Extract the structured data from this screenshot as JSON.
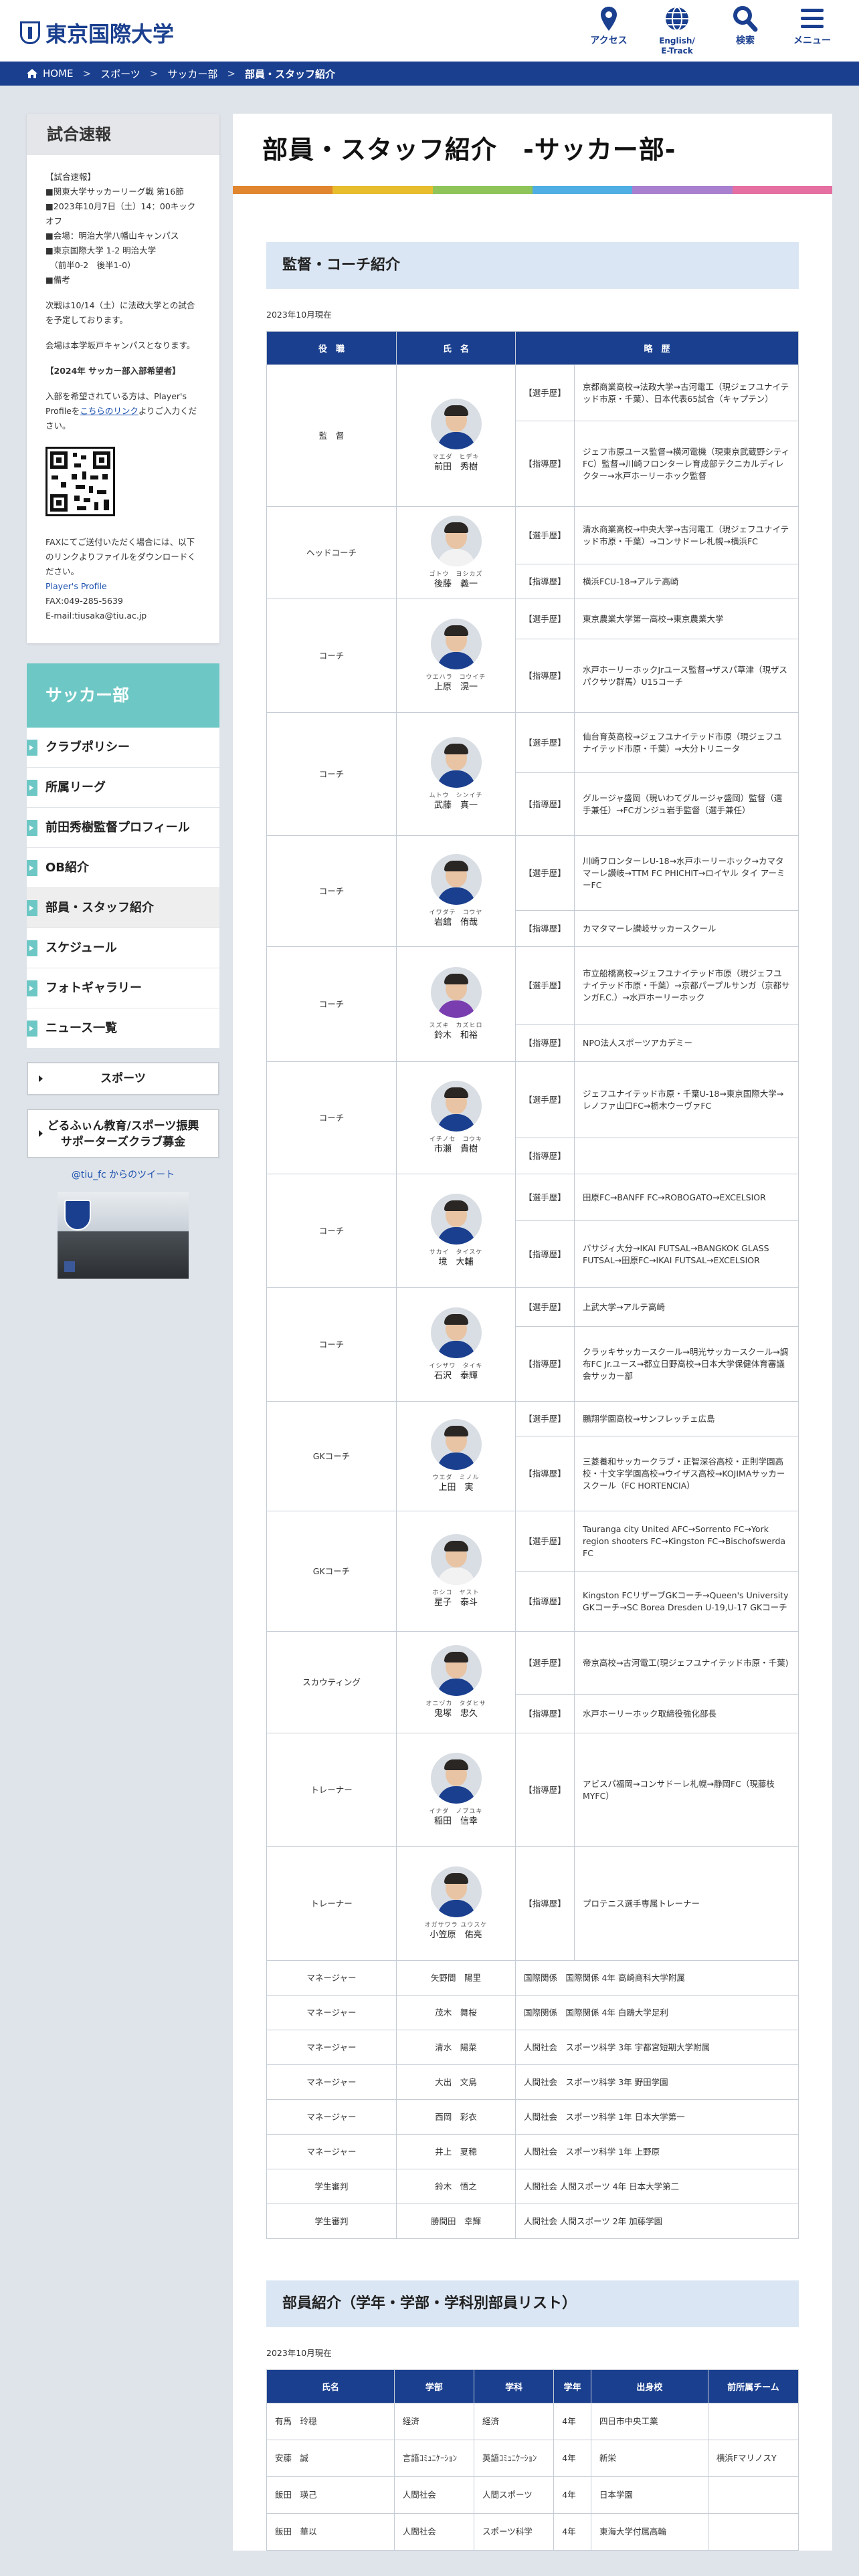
{
  "header": {
    "logo": "東京国際大学",
    "nav": [
      {
        "label": "アクセス",
        "icon": "map-pin-icon"
      },
      {
        "label": "English/ E-Track",
        "icon": "globe-icon"
      },
      {
        "label": "検索",
        "icon": "search-icon"
      },
      {
        "label": "メニュー",
        "icon": "menu-icon"
      }
    ]
  },
  "breadcrumb": [
    "HOME",
    "スポーツ",
    "サッカー部",
    "部員・スタッフ紹介"
  ],
  "side": {
    "title": "試合速報",
    "b1": "【試合速報】",
    "lines": [
      "■関東大学サッカーリーグ戦 第16節",
      "■2023年10月7日（土）14：00キックオフ",
      "■会場：明治大学八幡山キャンパス",
      "■東京国際大学 1-2 明治大学",
      "　（前半0-2　後半1-0）",
      "■備考"
    ],
    "p2": "次戦は10/14（土）に法政大学との試合を予定しております。",
    "p3": "会場は本学坂戸キャンパスとなります。",
    "b2": "【2024年 サッカー部入部希望者】",
    "p4a": "入部を希望されている方は、Player's Profileを",
    "p4link": "こちらのリンク",
    "p4b": "よりご入力ください。",
    "fax": "FAXにてご送付いただく場合には、以下のリンクよりファイルをダウンロードください。",
    "pp": "Player's Profile",
    "faxno": "FAX:049-285-5639",
    "mail": "E-mail:tiusaka@tiu.ac.jp"
  },
  "nav": {
    "title": "サッカー部",
    "items": [
      "クラブポリシー",
      "所属リーグ",
      "前田秀樹監督プロフィール",
      "OB紹介",
      "部員・スタッフ紹介",
      "スケジュール",
      "フォトギャラリー",
      "ニュース一覧"
    ],
    "active": 4
  },
  "sports": "スポーツ",
  "banner": [
    "どるふぃん教育/スポーツ振興",
    "サポーターズクラブ募金"
  ],
  "twitter": "@tiu_fc からのツイート",
  "page_title": "部員・スタッフ紹介　-サッカー部-",
  "stripe_colors": [
    "#e2852f",
    "#e7bc2d",
    "#8fc459",
    "#4faee3",
    "#a97fd0",
    "#e46fa0"
  ],
  "staff": {
    "title": "監督・コーチ紹介",
    "asof": "2023年10月現在",
    "headers": [
      "役　職",
      "氏　名",
      "略　歴"
    ],
    "rows": [
      {
        "role": "監　督",
        "furi": "マエダ　ヒデキ",
        "name": "前田　秀樹",
        "jersey": "#1b3f8f",
        "rows": [
          {
            "t": "【選手歴】",
            "h": "京都商業高校→法政大学→古河電工（現ジェフユナイテッド市原・千葉）、日本代表65試合（キャプテン）"
          },
          {
            "t": "【指導歴】",
            "h": "ジェフ市原ユース監督→横河電機（現東京武蔵野シティFC）監督→川崎フロンターレ育成部テクニカルディレクター→水戸ホーリーホック監督"
          }
        ]
      },
      {
        "role": "ヘッドコーチ",
        "furi": "ゴトウ　ヨシカズ",
        "name": "後藤　義一",
        "jersey": "#f2f2f2",
        "rows": [
          {
            "t": "【選手歴】",
            "h": "清水商業高校→中央大学→古河電工（現ジェフユナイテッド市原・千葉）→コンサドーレ札幌→横浜FC"
          },
          {
            "t": "【指導歴】",
            "h": "横浜FCU-18→アルテ高崎"
          }
        ]
      },
      {
        "role": "コーチ",
        "furi": "ウエハラ　コウイチ",
        "name": "上原　滉一",
        "jersey": "#1b3f8f",
        "rows": [
          {
            "t": "【選手歴】",
            "h": "東京農業大学第一高校→東京農業大学"
          },
          {
            "t": "【指導歴】",
            "h": "水戸ホーリーホックJrユース監督→ザスパ草津（現ザスパクサツ群馬）U15コーチ"
          }
        ]
      },
      {
        "role": "コーチ",
        "furi": "ムトウ　シンイチ",
        "name": "武藤　真一",
        "jersey": "#1b3f8f",
        "rows": [
          {
            "t": "【選手歴】",
            "h": "仙台育英高校→ジェフユナイテッド市原（現ジェフユナイテッド市原・千葉）→大分トリニータ"
          },
          {
            "t": "【指導歴】",
            "h": "グルージャ盛岡（現いわてグルージャ盛岡）監督（選手兼任）→FCガンジュ岩手監督（選手兼任）"
          }
        ]
      },
      {
        "role": "コーチ",
        "furi": "イワダテ　コウヤ",
        "name": "岩舘　侑哉",
        "jersey": "#1b3f8f",
        "rows": [
          {
            "t": "【選手歴】",
            "h": "川崎フロンターレU-18→水戸ホーリーホック→カマタマーレ讃岐→TTM FC PHICHIT→ロイヤル タイ アーミーFC"
          },
          {
            "t": "【指導歴】",
            "h": "カマタマーレ讃岐サッカースクール"
          }
        ]
      },
      {
        "role": "コーチ",
        "furi": "スズキ　カズヒロ",
        "name": "鈴木　和裕",
        "jersey": "#7a3db0",
        "rows": [
          {
            "t": "【選手歴】",
            "h": "市立船橋高校→ジェフユナイテッド市原（現ジェフユナイテッド市原・千葉）→京都パープルサンガ（京都サンガF.C.）→水戸ホーリーホック"
          },
          {
            "t": "【指導歴】",
            "h": "NPO法人スポーツアカデミー"
          }
        ]
      },
      {
        "role": "コーチ",
        "furi": "イチノセ　コウキ",
        "name": "市瀬　貴樹",
        "jersey": "#1b3f8f",
        "rows": [
          {
            "t": "【選手歴】",
            "h": "ジェフユナイテッド市原・千葉U-18→東京国際大学→レノファ山口FC→栃木ウーヴァFC"
          },
          {
            "t": "【指導歴】",
            "h": ""
          }
        ]
      },
      {
        "role": "コーチ",
        "furi": "サカイ　タイスケ",
        "name": "境　大輔",
        "jersey": "#1b3f8f",
        "rows": [
          {
            "t": "【選手歴】",
            "h": "田原FC→BANFF FC→ROBOGATO→EXCELSIOR"
          },
          {
            "t": "【指導歴】",
            "h": "バサジィ大分→IKAI FUTSAL→BANGKOK GLASS FUTSAL→田原FC→IKAI FUTSAL→EXCELSIOR"
          }
        ]
      },
      {
        "role": "コーチ",
        "furi": "イシザワ　タイキ",
        "name": "石沢　泰輝",
        "jersey": "#1b3f8f",
        "rows": [
          {
            "t": "【選手歴】",
            "h": "上武大学→アルテ高崎"
          },
          {
            "t": "【指導歴】",
            "h": "クラッキサッカースクール→明光サッカースクール→調布FC Jr.ユース→都立日野高校→日本大学保健体育審議会サッカー部"
          }
        ]
      },
      {
        "role": "GKコーチ",
        "furi": "ウエダ　ミノル",
        "name": "上田　実",
        "jersey": "#1b3f8f",
        "rows": [
          {
            "t": "【選手歴】",
            "h": "鵬翔学園高校→サンフレッチェ広島"
          },
          {
            "t": "【指導歴】",
            "h": "三菱養和サッカークラブ・正智深谷高校・正則学園高校・十文字学園高校→ウイザス高校→KOJIMAサッカースクール（FC HORTENCIA）"
          }
        ]
      },
      {
        "role": "GKコーチ",
        "furi": "ホシコ　ヤスト",
        "name": "星子　泰斗",
        "jersey": "#f2f2f2",
        "rows": [
          {
            "t": "【選手歴】",
            "h": "Tauranga city United AFC→Sorrento FC→York region shooters FC→Kingston FC→Bischofswerda FC"
          },
          {
            "t": "【指導歴】",
            "h": "Kingston FCリザーブGKコーチ→Queen's University GKコーチ→SC Borea Dresden U-19,U-17 GKコーチ"
          }
        ]
      },
      {
        "role": "スカウティング",
        "furi": "オニヅカ　タダヒサ",
        "name": "鬼塚　忠久",
        "jersey": "#1b3f8f",
        "rows": [
          {
            "t": "【選手歴】",
            "h": "帝京高校→古河電工(現ジェフユナイテッド市原・千葉)"
          },
          {
            "t": "【指導歴】",
            "h": "水戸ホーリーホック取締役強化部長"
          }
        ]
      },
      {
        "role": "トレーナー",
        "furi": "イナダ　ノブユキ",
        "name": "稲田　信幸",
        "jersey": "#1b3f8f",
        "rows": [
          {
            "t": "【指導歴】",
            "h": "アビスパ福岡→コンサドーレ札幌→静岡FC（現藤枝MYFC）"
          }
        ]
      },
      {
        "role": "トレーナー",
        "furi": "オガサワラ ユウスケ",
        "name": "小笠原　佑亮",
        "jersey": "#1b3f8f",
        "rows": [
          {
            "t": "【指導歴】",
            "h": "プロテニス選手専属トレーナー"
          }
        ]
      }
    ],
    "managers": [
      {
        "role": "マネージャー",
        "name": "矢野間　陽里",
        "info": "国際関係　国際関係 4年 高崎商科大学附属"
      },
      {
        "role": "マネージャー",
        "name": "茂木　舞桜",
        "info": "国際関係　国際関係 4年 白鴎大学足利"
      },
      {
        "role": "マネージャー",
        "name": "清水　陽菜",
        "info": "人間社会　スポーツ科学 3年 宇都宮短期大学附属"
      },
      {
        "role": "マネージャー",
        "name": "大出　文鳥",
        "info": "人間社会　スポーツ科学 3年 野田学園"
      },
      {
        "role": "マネージャー",
        "name": "西岡　彩衣",
        "info": "人間社会　スポーツ科学 1年 日本大学第一"
      },
      {
        "role": "マネージャー",
        "name": "井上　夏穂",
        "info": "人間社会　スポーツ科学 1年 上野原"
      },
      {
        "role": "学生審判",
        "name": "鈴木　悟之",
        "info": "人間社会 人間スポーツ 4年 日本大学第二"
      },
      {
        "role": "学生審判",
        "name": "勝間田　幸輝",
        "info": "人間社会 人間スポーツ 2年 加藤学園"
      }
    ]
  },
  "roster": {
    "title": "部員紹介（学年・学部・学科別部員リスト）",
    "asof": "2023年10月現在",
    "headers": [
      "氏名",
      "学部",
      "学科",
      "学年",
      "出身校",
      "前所属チーム"
    ],
    "rows": [
      [
        "有馬　玲穏",
        "経済",
        "経済",
        "4年",
        "四日市中央工業",
        ""
      ],
      [
        "安藤　誠",
        "言語ｺﾐｭﾆｹｰｼｮﾝ",
        "英語ｺﾐｭﾆｹｰｼｮﾝ",
        "4年",
        "新栄",
        "横浜FマリノスY"
      ],
      [
        "飯田　瑛己",
        "人間社会",
        "人間スポーツ",
        "4年",
        "日本学園",
        ""
      ],
      [
        "飯田　華以",
        "人間社会",
        "スポーツ科学",
        "4年",
        "東海大学付属高輪",
        ""
      ]
    ]
  }
}
